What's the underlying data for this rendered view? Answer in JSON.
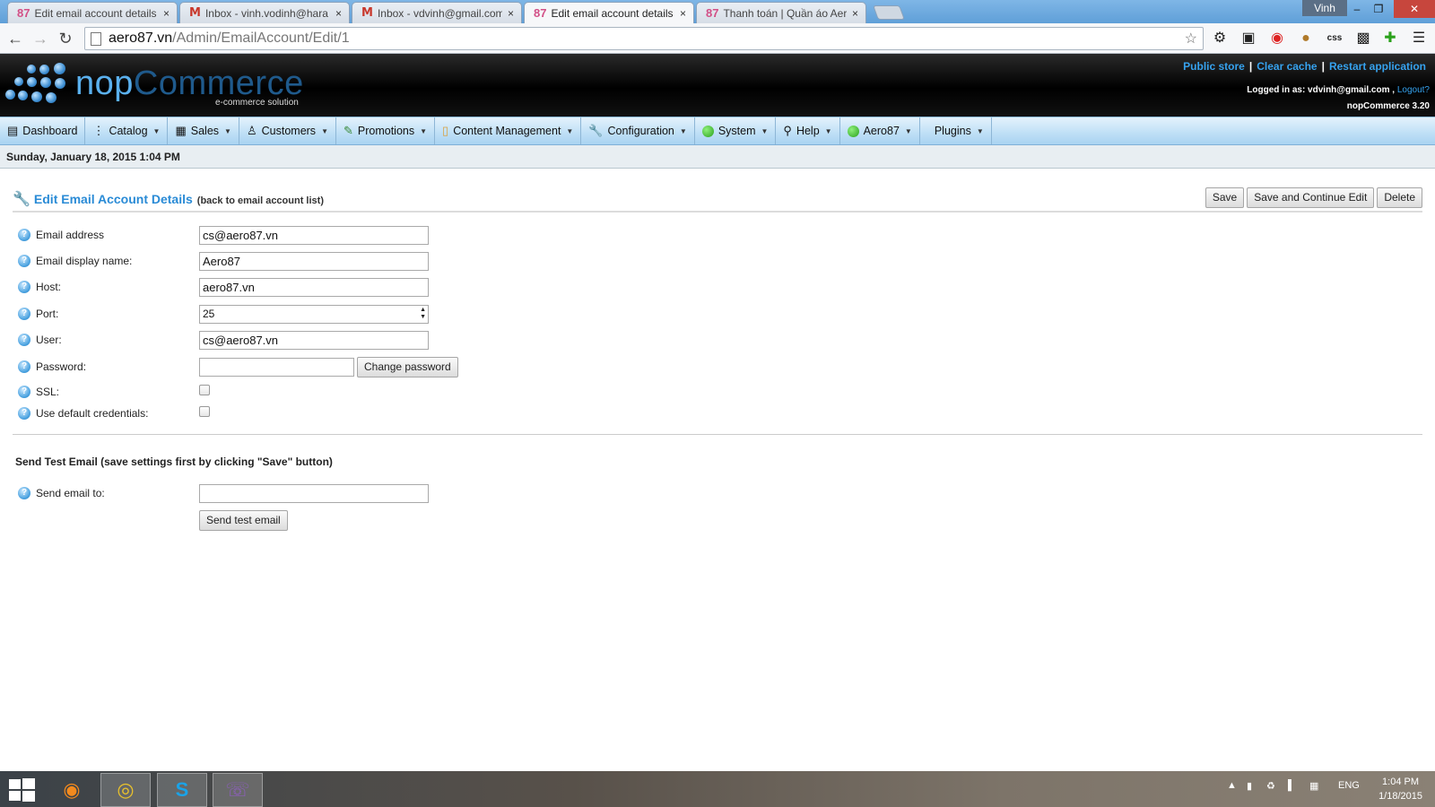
{
  "browser": {
    "tabs": [
      {
        "favicon": "87",
        "title": "Edit email account details",
        "active": false
      },
      {
        "favicon": "M",
        "title": "Inbox - vinh.vodinh@hara",
        "active": false
      },
      {
        "favicon": "M",
        "title": "Inbox - vdvinh@gmail.com",
        "active": false
      },
      {
        "favicon": "87",
        "title": "Edit email account details",
        "active": true
      },
      {
        "favicon": "87",
        "title": "Thanh toán | Quần áo Aer",
        "active": false
      }
    ],
    "tab_close": "×",
    "user": "Vinh",
    "url_host": "aero87.vn",
    "url_path": "/Admin/EmailAccount/Edit/1"
  },
  "header": {
    "logo_nop": "nop",
    "logo_commerce": "Commerce",
    "logo_sub": "e-commerce solution",
    "links": [
      "Public store",
      "Clear cache",
      "Restart application"
    ],
    "logged_in_label": "Logged in as: vdvinh@gmail.com ,",
    "logout": "Logout?",
    "version": "nopCommerce 3.20"
  },
  "menu": [
    {
      "label": "Dashboard",
      "icon": "dashboard-icon",
      "caret": false
    },
    {
      "label": "Catalog",
      "icon": "catalog-icon",
      "caret": true
    },
    {
      "label": "Sales",
      "icon": "sales-icon",
      "caret": true
    },
    {
      "label": "Customers",
      "icon": "customers-icon",
      "caret": true
    },
    {
      "label": "Promotions",
      "icon": "promotions-icon",
      "caret": true
    },
    {
      "label": "Content Management",
      "icon": "folder-icon",
      "caret": true
    },
    {
      "label": "Configuration",
      "icon": "wrench-icon",
      "caret": true
    },
    {
      "label": "System",
      "icon": "green-dot-icon",
      "caret": true
    },
    {
      "label": "Help",
      "icon": "help-icon",
      "caret": true
    },
    {
      "label": "Aero87",
      "icon": "green-dot-icon",
      "caret": true
    },
    {
      "label": "Plugins",
      "icon": "",
      "caret": true
    }
  ],
  "date": "Sunday, January 18, 2015 1:04 PM",
  "page": {
    "title": "Edit Email Account Details",
    "back_link": "(back to email account list)",
    "buttons": {
      "save": "Save",
      "save_continue": "Save and Continue Edit",
      "delete": "Delete"
    }
  },
  "form": {
    "email_label": "Email address",
    "email_value": "cs@aero87.vn",
    "display_name_label": "Email display name:",
    "display_name_value": "Aero87",
    "host_label": "Host:",
    "host_value": "aero87.vn",
    "port_label": "Port:",
    "port_value": "25",
    "user_label": "User:",
    "user_value": "cs@aero87.vn",
    "password_label": "Password:",
    "password_value": "",
    "change_password": "Change password",
    "ssl_label": "SSL:",
    "ssl_checked": false,
    "default_credentials_label": "Use default credentials:",
    "default_credentials_checked": false
  },
  "test_email": {
    "section_title": "Send Test Email (save settings first by clicking \"Save\" button)",
    "send_to_label": "Send email to:",
    "send_to_value": "",
    "send_button": "Send test email"
  },
  "taskbar": {
    "apps": [
      "firefox-icon",
      "chrome-icon",
      "skype-icon",
      "viber-icon"
    ],
    "language": "ENG",
    "time": "1:04 PM",
    "date": "1/18/2015"
  },
  "colors": {
    "accent_blue": "#2a8bd6",
    "header_link_blue": "#36a2ee",
    "menu_bg": "#bedff6"
  }
}
